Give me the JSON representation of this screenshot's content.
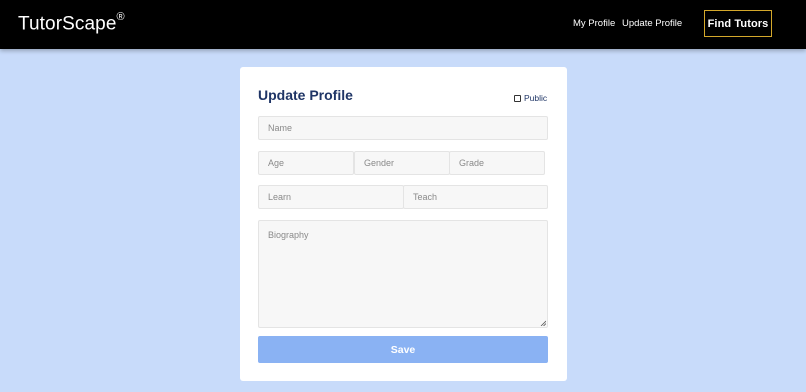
{
  "navbar": {
    "brand": "TutorScape",
    "brand_mark": "®",
    "links": [
      "My Profile",
      "Update Profile"
    ],
    "cta": "Find Tutors",
    "background": "#000000",
    "cta_border": "#d4a82b"
  },
  "form": {
    "title": "Update Profile",
    "public_label": "Public",
    "public_checked": false,
    "name_placeholder": "Name",
    "age_placeholder": "Age",
    "gender_placeholder": "Gender",
    "grade_placeholder": "Grade",
    "learn_placeholder": "Learn",
    "teach_placeholder": "Teach",
    "bio_placeholder": "Biography",
    "save_label": "Save",
    "save_color": "#8ab2f3"
  },
  "page": {
    "background": "#c8dbfa"
  }
}
